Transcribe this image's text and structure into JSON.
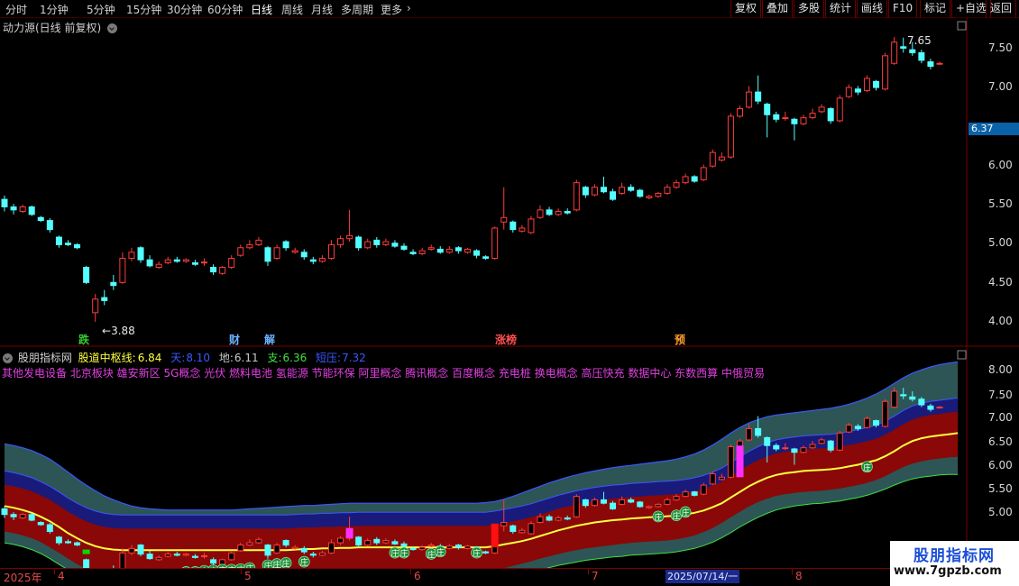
{
  "toolbar": {
    "periods": [
      "分时",
      "1分钟",
      "5分钟",
      "15分钟",
      "30分钟",
      "60分钟",
      "日线",
      "周线",
      "月线",
      "多周期",
      "更多"
    ],
    "active_period": "日线",
    "more_chevron": "›",
    "right_buttons": [
      "复权",
      "叠加",
      "多股",
      "统计",
      "画线",
      "F10",
      "标记",
      "+自选",
      "返回"
    ]
  },
  "upper": {
    "title": "动力源(日线 前复权)",
    "y_ticks": [
      "7.50",
      "7.00",
      "6.50",
      "6.00",
      "5.50",
      "5.00",
      "4.50",
      "4.00"
    ],
    "current_price": "6.37",
    "high_label": "7.65",
    "low_label": "3.88",
    "low_arrow": "←",
    "tags": [
      {
        "text": "跌",
        "color": "#33cc33"
      },
      {
        "text": "财",
        "color": "#6ab4ff"
      },
      {
        "text": "解",
        "color": "#6ab4ff"
      },
      {
        "text": "涨榜",
        "color": "#ff5050"
      },
      {
        "text": "预",
        "color": "#ffa030"
      }
    ]
  },
  "lower": {
    "indicator_name": "股朋指标网",
    "lines": [
      {
        "label": "股道中枢线:",
        "value": "6.84",
        "color": "#ffff40"
      },
      {
        "label": "天:",
        "value": "8.10",
        "color": "#3a58ff"
      },
      {
        "label": "地:",
        "value": "6.11",
        "color": "#c8c8c8"
      },
      {
        "label": "支:",
        "value": "6.36",
        "color": "#40e040"
      },
      {
        "label": "短压:",
        "value": "7.32",
        "color": "#3a58ff"
      }
    ],
    "concepts": "其他发电设备 北京板块 雄安新区 5G概念 光伏 燃料电池 氢能源 节能环保 阿里概念 腾讯概念 百度概念 充电桩 换电概念 高压快充 数据中心 东数西算 中俄贸易",
    "y_ticks": [
      "8.00",
      "7.50",
      "7.00",
      "6.50",
      "6.00",
      "5.50",
      "5.00"
    ],
    "marker_text": "庄"
  },
  "datebar": {
    "year": "2025年",
    "months": [
      "4",
      "5",
      "6",
      "7",
      "8"
    ],
    "cursor_date": "2025/07/14/一"
  },
  "watermark": {
    "title": "股朋指标网",
    "url": "www.7gpzb.com"
  },
  "colors": {
    "up": "#ff3b3b",
    "down": "#54ffff",
    "axis": "#7a0000",
    "band_outer": "#2f5a5a",
    "band_inner": "#8a0808",
    "band_core": "#1a1a7a"
  },
  "chart_data": {
    "type": "candlestick",
    "candles": [
      {
        "o": 5.5,
        "c": 5.4,
        "h": 5.55,
        "l": 5.34
      },
      {
        "o": 5.4,
        "c": 5.36,
        "h": 5.44,
        "l": 5.3
      },
      {
        "o": 5.34,
        "c": 5.4,
        "h": 5.43,
        "l": 5.32
      },
      {
        "o": 5.4,
        "c": 5.3,
        "h": 5.42,
        "l": 5.28
      },
      {
        "o": 5.26,
        "c": 5.22,
        "h": 5.28,
        "l": 5.2
      },
      {
        "o": 5.22,
        "c": 5.1,
        "h": 5.25,
        "l": 5.06
      },
      {
        "o": 5.0,
        "c": 4.9,
        "h": 5.02,
        "l": 4.86
      },
      {
        "o": 4.92,
        "c": 4.9,
        "h": 4.96,
        "l": 4.88
      },
      {
        "o": 4.9,
        "c": 4.86,
        "h": 4.92,
        "l": 4.84
      },
      {
        "o": 4.6,
        "c": 4.4,
        "h": 4.62,
        "l": 4.38
      },
      {
        "o": 4.0,
        "c": 4.18,
        "h": 4.25,
        "l": 3.88
      },
      {
        "o": 4.2,
        "c": 4.16,
        "h": 4.3,
        "l": 4.1
      },
      {
        "o": 4.4,
        "c": 4.36,
        "h": 4.5,
        "l": 4.3
      },
      {
        "o": 4.4,
        "c": 4.72,
        "h": 4.8,
        "l": 4.38
      },
      {
        "o": 4.72,
        "c": 4.8,
        "h": 4.86,
        "l": 4.68
      },
      {
        "o": 4.86,
        "c": 4.7,
        "h": 4.88,
        "l": 4.66
      },
      {
        "o": 4.7,
        "c": 4.62,
        "h": 4.76,
        "l": 4.6
      },
      {
        "o": 4.6,
        "c": 4.64,
        "h": 4.68,
        "l": 4.58
      },
      {
        "o": 4.66,
        "c": 4.7,
        "h": 4.74,
        "l": 4.64
      },
      {
        "o": 4.7,
        "c": 4.68,
        "h": 4.74,
        "l": 4.66
      },
      {
        "o": 4.68,
        "c": 4.7,
        "h": 4.72,
        "l": 4.66
      },
      {
        "o": 4.66,
        "c": 4.64,
        "h": 4.7,
        "l": 4.62
      },
      {
        "o": 4.66,
        "c": 4.67,
        "h": 4.72,
        "l": 4.62
      },
      {
        "o": 4.6,
        "c": 4.54,
        "h": 4.64,
        "l": 4.5
      },
      {
        "o": 4.52,
        "c": 4.6,
        "h": 4.62,
        "l": 4.5
      },
      {
        "o": 4.6,
        "c": 4.72,
        "h": 4.76,
        "l": 4.58
      },
      {
        "o": 4.76,
        "c": 4.86,
        "h": 4.9,
        "l": 4.74
      },
      {
        "o": 4.86,
        "c": 4.9,
        "h": 4.96,
        "l": 4.84
      },
      {
        "o": 4.9,
        "c": 4.96,
        "h": 5.0,
        "l": 4.88
      },
      {
        "o": 4.86,
        "c": 4.68,
        "h": 4.88,
        "l": 4.62
      },
      {
        "o": 4.72,
        "c": 4.86,
        "h": 4.9,
        "l": 4.7
      },
      {
        "o": 4.94,
        "c": 4.86,
        "h": 4.96,
        "l": 4.82
      },
      {
        "o": 4.8,
        "c": 4.82,
        "h": 4.86,
        "l": 4.78
      },
      {
        "o": 4.8,
        "c": 4.74,
        "h": 4.84,
        "l": 4.7
      },
      {
        "o": 4.7,
        "c": 4.68,
        "h": 4.74,
        "l": 4.64
      },
      {
        "o": 4.68,
        "c": 4.72,
        "h": 4.76,
        "l": 4.66
      },
      {
        "o": 4.72,
        "c": 4.9,
        "h": 4.96,
        "l": 4.7
      },
      {
        "o": 4.9,
        "c": 4.98,
        "h": 5.02,
        "l": 4.86
      },
      {
        "o": 4.98,
        "c": 5.02,
        "h": 5.36,
        "l": 4.94
      },
      {
        "o": 5.0,
        "c": 4.86,
        "h": 5.02,
        "l": 4.82
      },
      {
        "o": 4.86,
        "c": 4.94,
        "h": 4.98,
        "l": 4.84
      },
      {
        "o": 4.96,
        "c": 4.9,
        "h": 5.0,
        "l": 4.86
      },
      {
        "o": 4.9,
        "c": 4.94,
        "h": 4.98,
        "l": 4.88
      },
      {
        "o": 4.92,
        "c": 4.88,
        "h": 4.96,
        "l": 4.86
      },
      {
        "o": 4.88,
        "c": 4.84,
        "h": 4.92,
        "l": 4.82
      },
      {
        "o": 4.8,
        "c": 4.78,
        "h": 4.84,
        "l": 4.76
      },
      {
        "o": 4.78,
        "c": 4.82,
        "h": 4.86,
        "l": 4.76
      },
      {
        "o": 4.84,
        "c": 4.86,
        "h": 4.9,
        "l": 4.82
      },
      {
        "o": 4.84,
        "c": 4.8,
        "h": 4.88,
        "l": 4.78
      },
      {
        "o": 4.8,
        "c": 4.84,
        "h": 4.88,
        "l": 4.78
      },
      {
        "o": 4.86,
        "c": 4.82,
        "h": 4.88,
        "l": 4.78
      },
      {
        "o": 4.8,
        "c": 4.84,
        "h": 4.86,
        "l": 4.78
      },
      {
        "o": 4.82,
        "c": 4.76,
        "h": 4.84,
        "l": 4.72
      },
      {
        "o": 4.74,
        "c": 4.72,
        "h": 4.76,
        "l": 4.7
      },
      {
        "o": 4.72,
        "c": 5.12,
        "h": 5.14,
        "l": 4.7
      },
      {
        "o": 5.2,
        "c": 5.26,
        "h": 5.66,
        "l": 5.1
      },
      {
        "o": 5.2,
        "c": 5.1,
        "h": 5.22,
        "l": 5.06
      },
      {
        "o": 5.08,
        "c": 5.12,
        "h": 5.16,
        "l": 5.06
      },
      {
        "o": 5.06,
        "c": 5.24,
        "h": 5.28,
        "l": 5.04
      },
      {
        "o": 5.26,
        "c": 5.36,
        "h": 5.42,
        "l": 5.24
      },
      {
        "o": 5.36,
        "c": 5.3,
        "h": 5.4,
        "l": 5.28
      },
      {
        "o": 5.3,
        "c": 5.34,
        "h": 5.38,
        "l": 5.28
      },
      {
        "o": 5.34,
        "c": 5.32,
        "h": 5.38,
        "l": 5.3
      },
      {
        "o": 5.36,
        "c": 5.72,
        "h": 5.76,
        "l": 5.34
      },
      {
        "o": 5.66,
        "c": 5.56,
        "h": 5.68,
        "l": 5.52
      },
      {
        "o": 5.56,
        "c": 5.66,
        "h": 5.7,
        "l": 5.54
      },
      {
        "o": 5.66,
        "c": 5.6,
        "h": 5.8,
        "l": 5.58
      },
      {
        "o": 5.6,
        "c": 5.5,
        "h": 5.64,
        "l": 5.48
      },
      {
        "o": 5.58,
        "c": 5.66,
        "h": 5.72,
        "l": 5.56
      },
      {
        "o": 5.66,
        "c": 5.62,
        "h": 5.7,
        "l": 5.6
      },
      {
        "o": 5.62,
        "c": 5.54,
        "h": 5.64,
        "l": 5.52
      },
      {
        "o": 5.52,
        "c": 5.54,
        "h": 5.56,
        "l": 5.5
      },
      {
        "o": 5.54,
        "c": 5.58,
        "h": 5.6,
        "l": 5.52
      },
      {
        "o": 5.58,
        "c": 5.66,
        "h": 5.7,
        "l": 5.56
      },
      {
        "o": 5.66,
        "c": 5.72,
        "h": 5.76,
        "l": 5.64
      },
      {
        "o": 5.72,
        "c": 5.8,
        "h": 5.84,
        "l": 5.7
      },
      {
        "o": 5.8,
        "c": 5.74,
        "h": 5.82,
        "l": 5.72
      },
      {
        "o": 5.76,
        "c": 5.92,
        "h": 5.96,
        "l": 5.74
      },
      {
        "o": 5.94,
        "c": 6.12,
        "h": 6.16,
        "l": 5.92
      },
      {
        "o": 6.02,
        "c": 6.06,
        "h": 6.12,
        "l": 6.0
      },
      {
        "o": 6.06,
        "c": 6.6,
        "h": 6.64,
        "l": 6.04
      },
      {
        "o": 6.6,
        "c": 6.7,
        "h": 6.74,
        "l": 6.58
      },
      {
        "o": 6.72,
        "c": 6.92,
        "h": 7.0,
        "l": 6.7
      },
      {
        "o": 6.92,
        "c": 6.8,
        "h": 7.14,
        "l": 6.76
      },
      {
        "o": 6.76,
        "c": 6.62,
        "h": 6.78,
        "l": 6.32
      },
      {
        "o": 6.62,
        "c": 6.56,
        "h": 6.66,
        "l": 6.52
      },
      {
        "o": 6.58,
        "c": 6.58,
        "h": 6.66,
        "l": 6.54
      },
      {
        "o": 6.56,
        "c": 6.5,
        "h": 6.58,
        "l": 6.28
      },
      {
        "o": 6.5,
        "c": 6.58,
        "h": 6.62,
        "l": 6.48
      },
      {
        "o": 6.58,
        "c": 6.64,
        "h": 6.7,
        "l": 6.56
      },
      {
        "o": 6.66,
        "c": 6.72,
        "h": 6.76,
        "l": 6.64
      },
      {
        "o": 6.7,
        "c": 6.54,
        "h": 6.72,
        "l": 6.5
      },
      {
        "o": 6.54,
        "c": 6.84,
        "h": 6.88,
        "l": 6.52
      },
      {
        "o": 6.86,
        "c": 6.98,
        "h": 7.02,
        "l": 6.84
      },
      {
        "o": 6.96,
        "c": 6.92,
        "h": 7.0,
        "l": 6.88
      },
      {
        "o": 6.94,
        "c": 7.1,
        "h": 7.14,
        "l": 6.92
      },
      {
        "o": 7.06,
        "c": 6.98,
        "h": 7.08,
        "l": 6.94
      },
      {
        "o": 6.96,
        "c": 7.4,
        "h": 7.44,
        "l": 6.94
      },
      {
        "o": 7.3,
        "c": 7.58,
        "h": 7.65,
        "l": 7.28
      },
      {
        "o": 7.52,
        "c": 7.5,
        "h": 7.64,
        "l": 7.44
      },
      {
        "o": 7.48,
        "c": 7.44,
        "h": 7.58,
        "l": 7.4
      },
      {
        "o": 7.44,
        "c": 7.34,
        "h": 7.48,
        "l": 7.3
      },
      {
        "o": 7.32,
        "c": 7.26,
        "h": 7.36,
        "l": 7.22
      },
      {
        "o": 7.3,
        "c": 7.3,
        "h": 7.32,
        "l": 7.28
      }
    ],
    "y_range_upper": [
      3.7,
      7.78
    ],
    "y_range_lower": [
      4.55,
      8.25
    ],
    "series": [
      {
        "name": "股道中枢线",
        "values": [
          5.55,
          5.52,
          5.48,
          5.43,
          5.36,
          5.28,
          5.18,
          5.07,
          4.98,
          4.9,
          4.84,
          4.8,
          4.78,
          4.77,
          4.77,
          4.77,
          4.77,
          4.77,
          4.77,
          4.77,
          4.77,
          4.77,
          4.77,
          4.77,
          4.77,
          4.77,
          4.77,
          4.77,
          4.77,
          4.77,
          4.77,
          4.77,
          4.78,
          4.79,
          4.79,
          4.8,
          4.8,
          4.81,
          4.81,
          4.82,
          4.82,
          4.82,
          4.82,
          4.82,
          4.82,
          4.82,
          4.82,
          4.82,
          4.82,
          4.82,
          4.82,
          4.82,
          4.82,
          4.82,
          4.84,
          4.87,
          4.9,
          4.93,
          4.97,
          5.02,
          5.07,
          5.12,
          5.16,
          5.2,
          5.23,
          5.26,
          5.28,
          5.3,
          5.31,
          5.33,
          5.34,
          5.35,
          5.36,
          5.37,
          5.38,
          5.4,
          5.43,
          5.47,
          5.53,
          5.6,
          5.7,
          5.8,
          5.9,
          5.98,
          6.05,
          6.1,
          6.13,
          6.15,
          6.17,
          6.18,
          6.19,
          6.2,
          6.22,
          6.25,
          6.28,
          6.32,
          6.36,
          6.43,
          6.52,
          6.62,
          6.7,
          6.75,
          6.78,
          6.8,
          6.82,
          6.84
        ]
      },
      {
        "name": "天",
        "values": [
          6.65,
          6.62,
          6.58,
          6.53,
          6.46,
          6.38,
          6.27,
          6.15,
          6.03,
          5.92,
          5.82,
          5.73,
          5.66,
          5.6,
          5.55,
          5.52,
          5.5,
          5.49,
          5.48,
          5.48,
          5.48,
          5.48,
          5.48,
          5.48,
          5.48,
          5.48,
          5.49,
          5.5,
          5.51,
          5.52,
          5.53,
          5.54,
          5.55,
          5.56,
          5.56,
          5.57,
          5.58,
          5.59,
          5.6,
          5.6,
          5.6,
          5.6,
          5.6,
          5.6,
          5.6,
          5.6,
          5.6,
          5.6,
          5.6,
          5.6,
          5.6,
          5.6,
          5.6,
          5.61,
          5.63,
          5.67,
          5.72,
          5.78,
          5.84,
          5.9,
          5.96,
          6.01,
          6.06,
          6.1,
          6.14,
          6.17,
          6.2,
          6.23,
          6.25,
          6.27,
          6.29,
          6.31,
          6.33,
          6.35,
          6.38,
          6.42,
          6.47,
          6.54,
          6.63,
          6.73,
          6.84,
          6.94,
          7.02,
          7.08,
          7.13,
          7.16,
          7.18,
          7.2,
          7.22,
          7.24,
          7.26,
          7.28,
          7.31,
          7.35,
          7.4,
          7.46,
          7.53,
          7.62,
          7.72,
          7.82,
          7.9,
          7.96,
          8.01,
          8.05,
          8.08,
          8.1
        ]
      },
      {
        "name": "地",
        "values": [
          4.9,
          4.87,
          4.83,
          4.78,
          4.71,
          4.62,
          4.52,
          4.42,
          4.33,
          4.26,
          4.21,
          4.17,
          4.15,
          4.14,
          4.14,
          4.14,
          4.14,
          4.14,
          4.14,
          4.14,
          4.14,
          4.14,
          4.14,
          4.14,
          4.14,
          4.14,
          4.14,
          4.15,
          4.16,
          4.17,
          4.18,
          4.19,
          4.2,
          4.2,
          4.21,
          4.21,
          4.21,
          4.22,
          4.22,
          4.22,
          4.22,
          4.22,
          4.22,
          4.22,
          4.22,
          4.22,
          4.22,
          4.22,
          4.22,
          4.22,
          4.22,
          4.22,
          4.22,
          4.22,
          4.24,
          4.27,
          4.3,
          4.34,
          4.38,
          4.42,
          4.46,
          4.5,
          4.53,
          4.56,
          4.59,
          4.61,
          4.63,
          4.65,
          4.66,
          4.68,
          4.69,
          4.7,
          4.71,
          4.72,
          4.74,
          4.77,
          4.8,
          4.85,
          4.91,
          4.99,
          5.08,
          5.18,
          5.27,
          5.35,
          5.42,
          5.48,
          5.52,
          5.55,
          5.57,
          5.59,
          5.6,
          5.62,
          5.64,
          5.67,
          5.7,
          5.74,
          5.79,
          5.85,
          5.92,
          5.98,
          6.03,
          6.06,
          6.08,
          6.1,
          6.11,
          6.11
        ]
      },
      {
        "name": "支",
        "values": [
          5.3,
          5.27,
          5.23,
          5.18,
          5.11,
          5.02,
          4.92,
          4.82,
          4.72,
          4.64,
          4.58,
          4.54,
          4.51,
          4.5,
          4.49,
          4.49,
          4.49,
          4.49,
          4.49,
          4.49,
          4.49,
          4.49,
          4.49,
          4.49,
          4.49,
          4.49,
          4.5,
          4.51,
          4.52,
          4.53,
          4.54,
          4.55,
          4.56,
          4.57,
          4.58,
          4.59,
          4.59,
          4.6,
          4.6,
          4.6,
          4.6,
          4.6,
          4.6,
          4.6,
          4.6,
          4.6,
          4.6,
          4.6,
          4.6,
          4.6,
          4.6,
          4.6,
          4.6,
          4.6,
          4.62,
          4.65,
          4.69,
          4.73,
          4.77,
          4.82,
          4.86,
          4.9,
          4.94,
          4.97,
          5.0,
          5.02,
          5.04,
          5.06,
          5.08,
          5.1,
          5.11,
          5.12,
          5.13,
          5.14,
          5.16,
          5.19,
          5.23,
          5.29,
          5.36,
          5.45,
          5.55,
          5.65,
          5.74,
          5.82,
          5.88,
          5.93,
          5.96,
          5.98,
          6.0,
          6.01,
          6.02,
          6.04,
          6.06,
          6.09,
          6.12,
          6.16,
          6.21,
          6.28,
          6.36,
          6.44,
          6.5,
          6.54,
          6.57,
          6.59,
          6.61,
          6.62
        ]
      }
    ]
  }
}
